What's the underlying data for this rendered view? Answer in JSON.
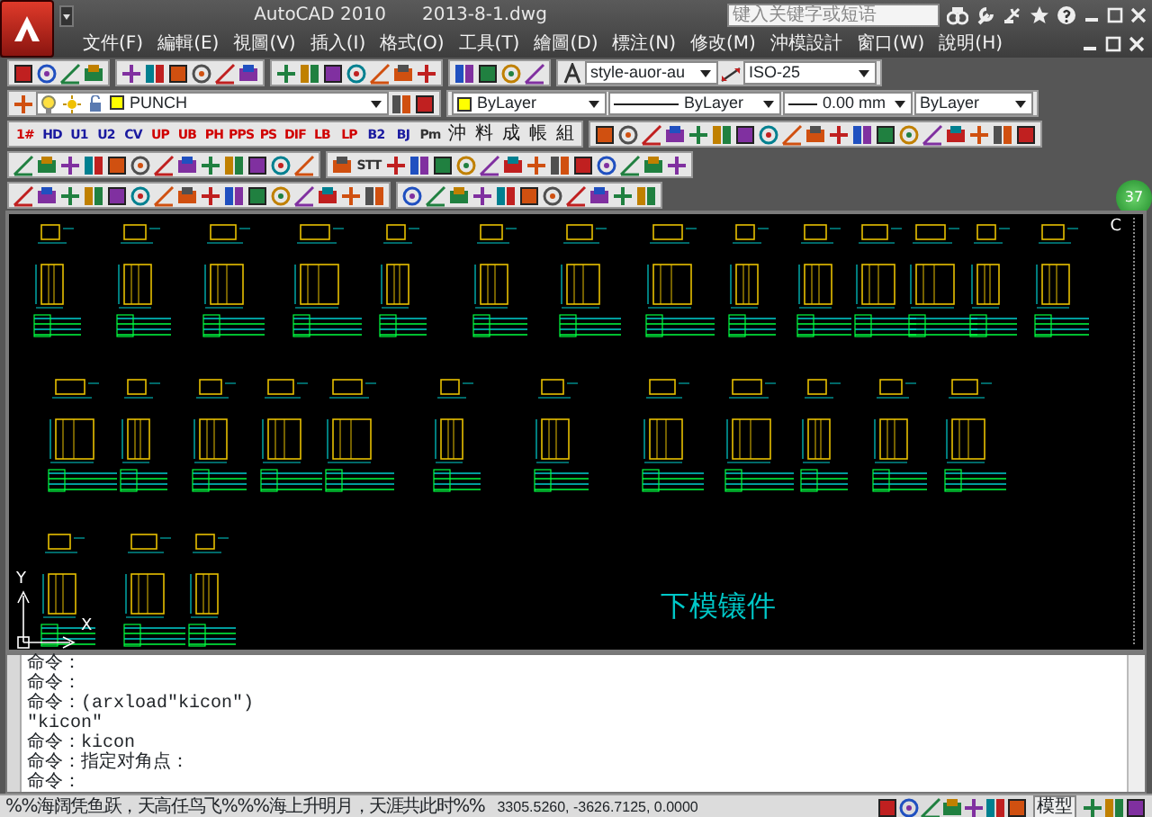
{
  "title_bar": {
    "app": "AutoCAD 2010",
    "file": "2013-8-1.dwg",
    "search": {
      "placeholder": "键入关键字或短语"
    }
  },
  "menu": [
    "文件(F)",
    "編輯(E)",
    "視圖(V)",
    "插入(I)",
    "格式(O)",
    "工具(T)",
    "繪圖(D)",
    "標注(N)",
    "修改(M)",
    "沖模設計",
    "窗口(W)",
    "說明(H)"
  ],
  "styles_toolbar": {
    "text_style": "style-auor-au",
    "dim_style": "ISO-25"
  },
  "properties_toolbar": {
    "layer": "PUNCH",
    "color_setting": "ByLayer",
    "linetype": "ByLayer",
    "lineweight": "0.00 mm",
    "plot_style": "ByLayer"
  },
  "punch_toolbar": {
    "tools": [
      {
        "label": "1#",
        "color": "#d00000"
      },
      {
        "label": "HD",
        "color": "#1a1aa0"
      },
      {
        "label": "U1",
        "color": "#1a1aa0"
      },
      {
        "label": "U2",
        "color": "#1a1aa0"
      },
      {
        "label": "CV",
        "color": "#1a1aa0"
      },
      {
        "label": "UP",
        "color": "#d00000"
      },
      {
        "label": "UB",
        "color": "#d00000"
      },
      {
        "label": "PH",
        "color": "#d00000"
      },
      {
        "label": "PPS",
        "color": "#d00000"
      },
      {
        "label": "PS",
        "color": "#d00000"
      },
      {
        "label": "DIF",
        "color": "#d00000"
      },
      {
        "label": "LB",
        "color": "#d00000"
      },
      {
        "label": "LP",
        "color": "#d00000"
      },
      {
        "label": "B2",
        "color": "#1a1aa0"
      },
      {
        "label": "BJ",
        "color": "#1a1aa0"
      },
      {
        "label": "Pm",
        "color": "#333333"
      },
      {
        "label": "沖",
        "color": "#111111"
      },
      {
        "label": "料",
        "color": "#111111"
      },
      {
        "label": "成",
        "color": "#111111"
      },
      {
        "label": "帳",
        "color": "#111111"
      },
      {
        "label": "組",
        "color": "#111111"
      }
    ]
  },
  "draw_toolbar": {
    "tools": [
      {
        "label": "STT",
        "color": "#333333"
      }
    ]
  },
  "notification_badge": "37",
  "canvas": {
    "label": "下模镶件",
    "corner_mark": "C",
    "ucs": {
      "x": "X",
      "y": "Y"
    }
  },
  "command_history": [
    "命令：",
    "命令：",
    "命令：(arxload\"kicon\")",
    "\"kicon\"",
    "命令：kicon",
    "命令：指定对角点：",
    "命令："
  ],
  "status_bar": {
    "message": "%%海阔凭鱼跃，天高任鸟飞%%%海上升明月，天涯共此时%%",
    "coordinates": "3305.5260, -3626.7125, 0.0000",
    "space": "模型"
  }
}
